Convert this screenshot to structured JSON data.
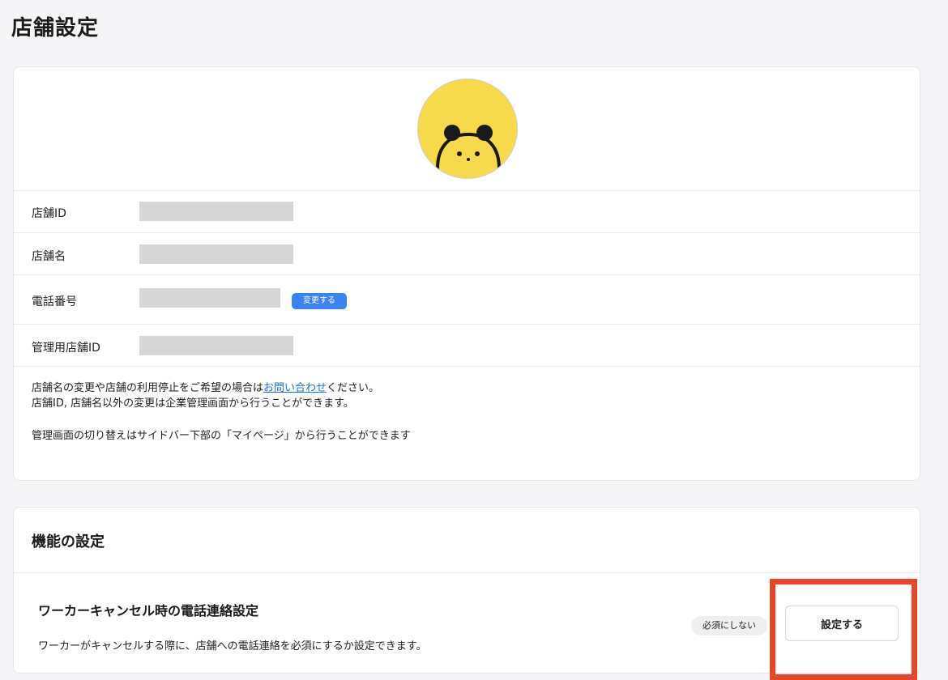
{
  "page": {
    "title": "店舗設定"
  },
  "store_card": {
    "fields": [
      {
        "label": "店舗ID",
        "value_masked": true
      },
      {
        "label": "店舗名",
        "value_masked": true
      },
      {
        "label": "電話番号",
        "value_masked": true,
        "action_label": "変更する"
      },
      {
        "label": "管理用店舗ID",
        "value_masked": true
      }
    ],
    "notes": {
      "line1_prefix": "店舗名の変更や店舗の利用停止をご希望の場合は",
      "line1_link": "お問い合わせ",
      "line1_suffix": "ください。",
      "line2": "店舗ID, 店舗名以外の変更は企業管理画面から行うことができます。",
      "line3": "管理画面の切り替えはサイドバー下部の「マイページ」から行うことができます"
    }
  },
  "features_card": {
    "title": "機能の設定",
    "items": [
      {
        "name": "ワーカーキャンセル時の電話連絡設定",
        "description": "ワーカーがキャンセルする際に、店舗への電話連絡を必須にするか設定できます。",
        "status": "必須にしない",
        "button_label": "設定する"
      }
    ]
  },
  "colors": {
    "accent_blue": "#3b82f6",
    "link_blue": "#1f6fe0",
    "avatar_yellow": "#f7d94c",
    "highlight_red": "#e8452b"
  }
}
